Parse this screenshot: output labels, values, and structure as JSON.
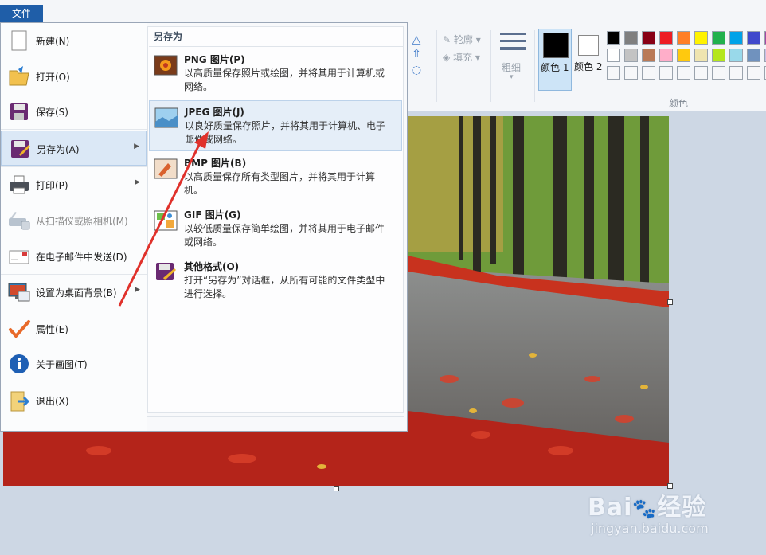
{
  "file_tab": "文件",
  "ribbon": {
    "outline": "轮廓",
    "fill": "填充",
    "size": "粗细",
    "color1": "颜色 1",
    "color2": "颜色 2",
    "colors_group": "颜色",
    "palette_row1": [
      "#000000",
      "#7f7f7f",
      "#880015",
      "#ed1c24",
      "#ff7f27",
      "#fff200",
      "#22b14c",
      "#00a2e8",
      "#3f48cc",
      "#a349a4"
    ],
    "palette_row2": [
      "#ffffff",
      "#c3c3c3",
      "#b97a57",
      "#ffaec9",
      "#ffc90e",
      "#efe4b0",
      "#b5e61d",
      "#99d9ea",
      "#7092be",
      "#c8bfe7"
    ]
  },
  "menu": {
    "items": [
      {
        "label": "新建(N)",
        "icon": "new-document-icon"
      },
      {
        "label": "打开(O)",
        "icon": "open-folder-icon"
      },
      {
        "label": "保存(S)",
        "icon": "save-disk-icon"
      },
      {
        "label": "另存为(A)",
        "icon": "save-as-icon"
      },
      {
        "label": "打印(P)",
        "icon": "printer-icon"
      },
      {
        "label": "从扫描仪或照相机(M)",
        "icon": "scanner-icon"
      },
      {
        "label": "在电子邮件中发送(D)",
        "icon": "email-icon"
      },
      {
        "label": "设置为桌面背景(B)",
        "icon": "desktop-icon"
      },
      {
        "label": "属性(E)",
        "icon": "checkmark-icon"
      },
      {
        "label": "关于画图(T)",
        "icon": "info-icon"
      },
      {
        "label": "退出(X)",
        "icon": "exit-icon"
      }
    ]
  },
  "submenu": {
    "title": "另存为",
    "items": [
      {
        "title": "PNG 图片(P)",
        "desc": "以高质量保存照片或绘图，并将其用于计算机或网络。",
        "icon": "png-image-icon"
      },
      {
        "title": "JPEG 图片(J)",
        "desc": "以良好质量保存照片，并将其用于计算机、电子邮件或网络。",
        "icon": "jpeg-image-icon"
      },
      {
        "title": "BMP 图片(B)",
        "desc": "以高质量保存所有类型图片，并将其用于计算机。",
        "icon": "bmp-image-icon"
      },
      {
        "title": "GIF 图片(G)",
        "desc": "以较低质量保存简单绘图，并将其用于电子邮件或网络。",
        "icon": "gif-image-icon"
      },
      {
        "title": "其他格式(O)",
        "desc": "打开“另存为”对话框，从所有可能的文件类型中进行选择。",
        "icon": "other-formats-icon"
      }
    ]
  },
  "watermark": {
    "logo": "Bai🐾经验",
    "url": "jingyan.baidu.com"
  },
  "colors": {
    "accent": "#1f5ea8",
    "highlight": "#dbe8f6",
    "annotation_arrow": "#e0312b"
  }
}
